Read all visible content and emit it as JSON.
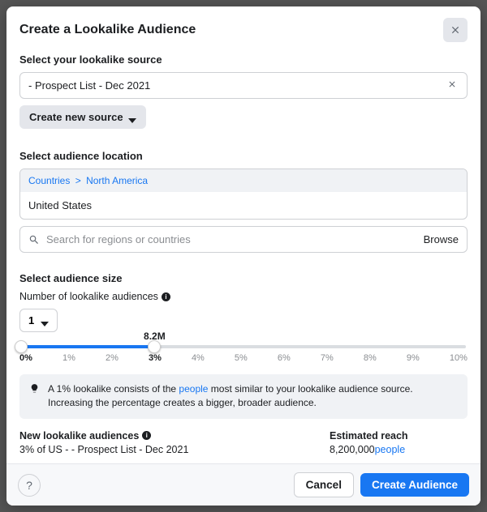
{
  "modal": {
    "title": "Create a Lookalike Audience"
  },
  "source": {
    "section_label": "Select your lookalike source",
    "value": "- Prospect List - Dec 2021",
    "create_button": "Create new source"
  },
  "location": {
    "section_label": "Select audience location",
    "breadcrumb_root": "Countries",
    "breadcrumb_region": "North America",
    "selected": "United States",
    "search_placeholder": "Search for regions or countries",
    "browse_label": "Browse"
  },
  "size": {
    "section_label": "Select audience size",
    "count_label": "Number of lookalike audiences",
    "count_value": "1",
    "slider": {
      "bubble": "8.2M",
      "start_pct": 0,
      "end_pct": 30,
      "ticks": [
        "0%",
        "1%",
        "2%",
        "3%",
        "4%",
        "5%",
        "6%",
        "7%",
        "8%",
        "9%",
        "10%"
      ],
      "active_tick_indices": [
        0,
        3
      ]
    },
    "tip_pre": "A 1% lookalike consists of the ",
    "tip_people": "people",
    "tip_post": " most similar to your lookalike audience source. Increasing the percentage creates a bigger, broader audience."
  },
  "results": {
    "new_label": "New lookalike audiences",
    "new_value": "3% of US -       - Prospect List - Dec 2021",
    "reach_label": "Estimated reach",
    "reach_value": "8,200,000",
    "reach_people": "people"
  },
  "footer": {
    "cancel": "Cancel",
    "submit": "Create Audience"
  }
}
